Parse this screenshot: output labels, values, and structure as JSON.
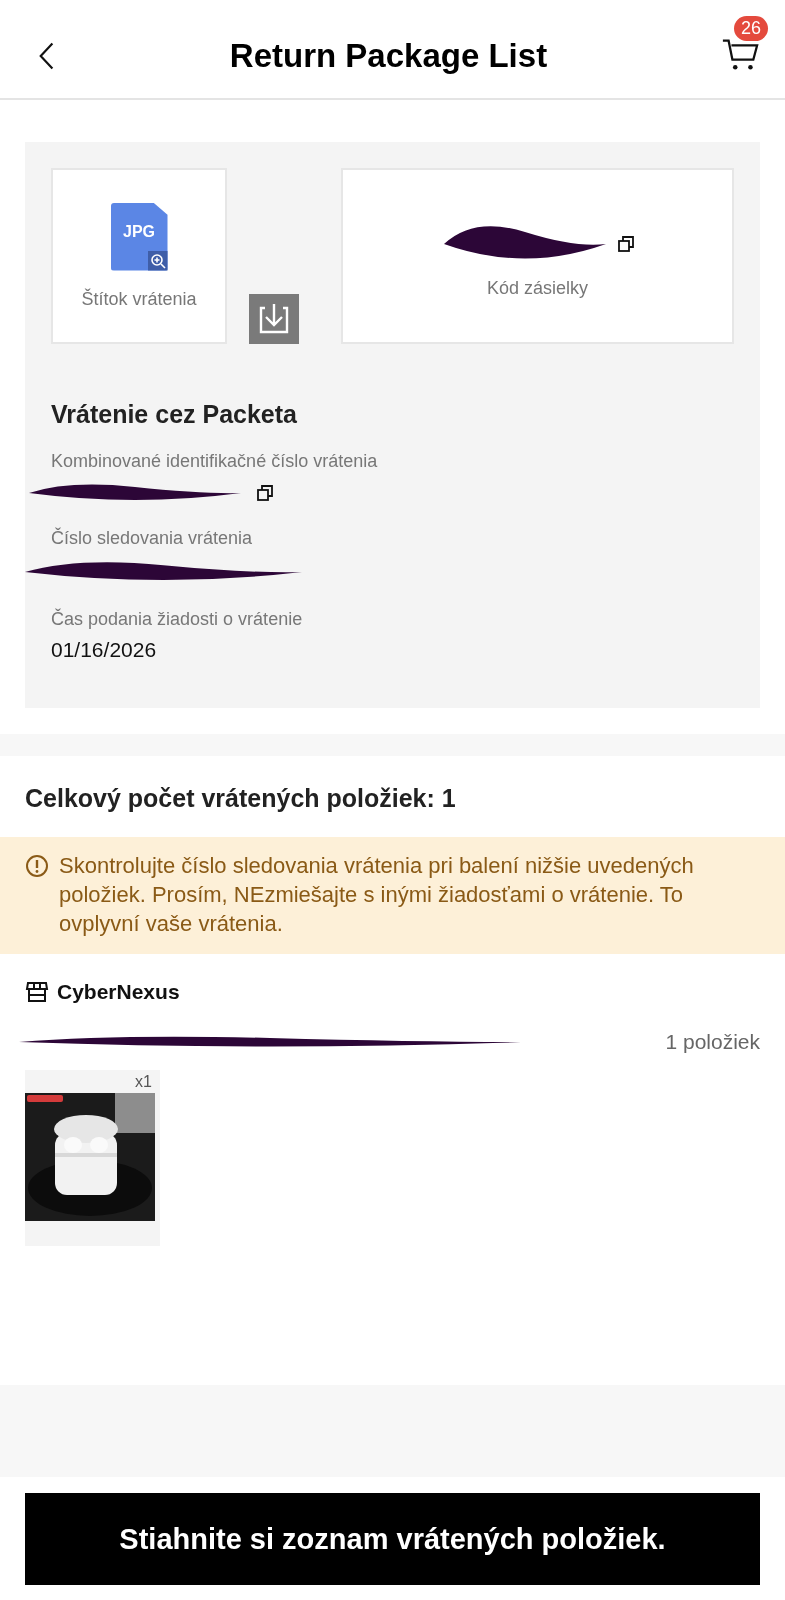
{
  "header": {
    "title": "Return Package List",
    "cart_badge": "26"
  },
  "label_card": {
    "file_type": "JPG",
    "caption": "Štítok vrátenia"
  },
  "code_card": {
    "caption": "Kód zásielky"
  },
  "return_info": {
    "title": "Vrátenie cez Packeta",
    "fields": [
      {
        "label": "Kombinované identifikačné číslo vrátenia",
        "kind": "redacted-copy"
      },
      {
        "label": "Číslo sledovania vrátenia",
        "kind": "redacted"
      },
      {
        "label": "Čas podania žiadosti o vrátenie",
        "kind": "text",
        "value": "01/16/2026"
      }
    ]
  },
  "summary": {
    "title": "Celkový počet vrátených položiek: 1"
  },
  "warning": {
    "text": "Skontrolujte číslo sledovania vrátenia pri balení nižšie uvedených položiek. Prosím, NEzmiešajte s inými žiadosťami o vrátenie. To ovplyvní vaše vrátenia."
  },
  "store": {
    "name": "CyberNexus",
    "item_count": "1 položiek",
    "products": [
      {
        "kind": "picture",
        "quantity": "x1"
      }
    ]
  },
  "download_button": {
    "label": "Stiahnite si zoznam vrátených položiek."
  }
}
